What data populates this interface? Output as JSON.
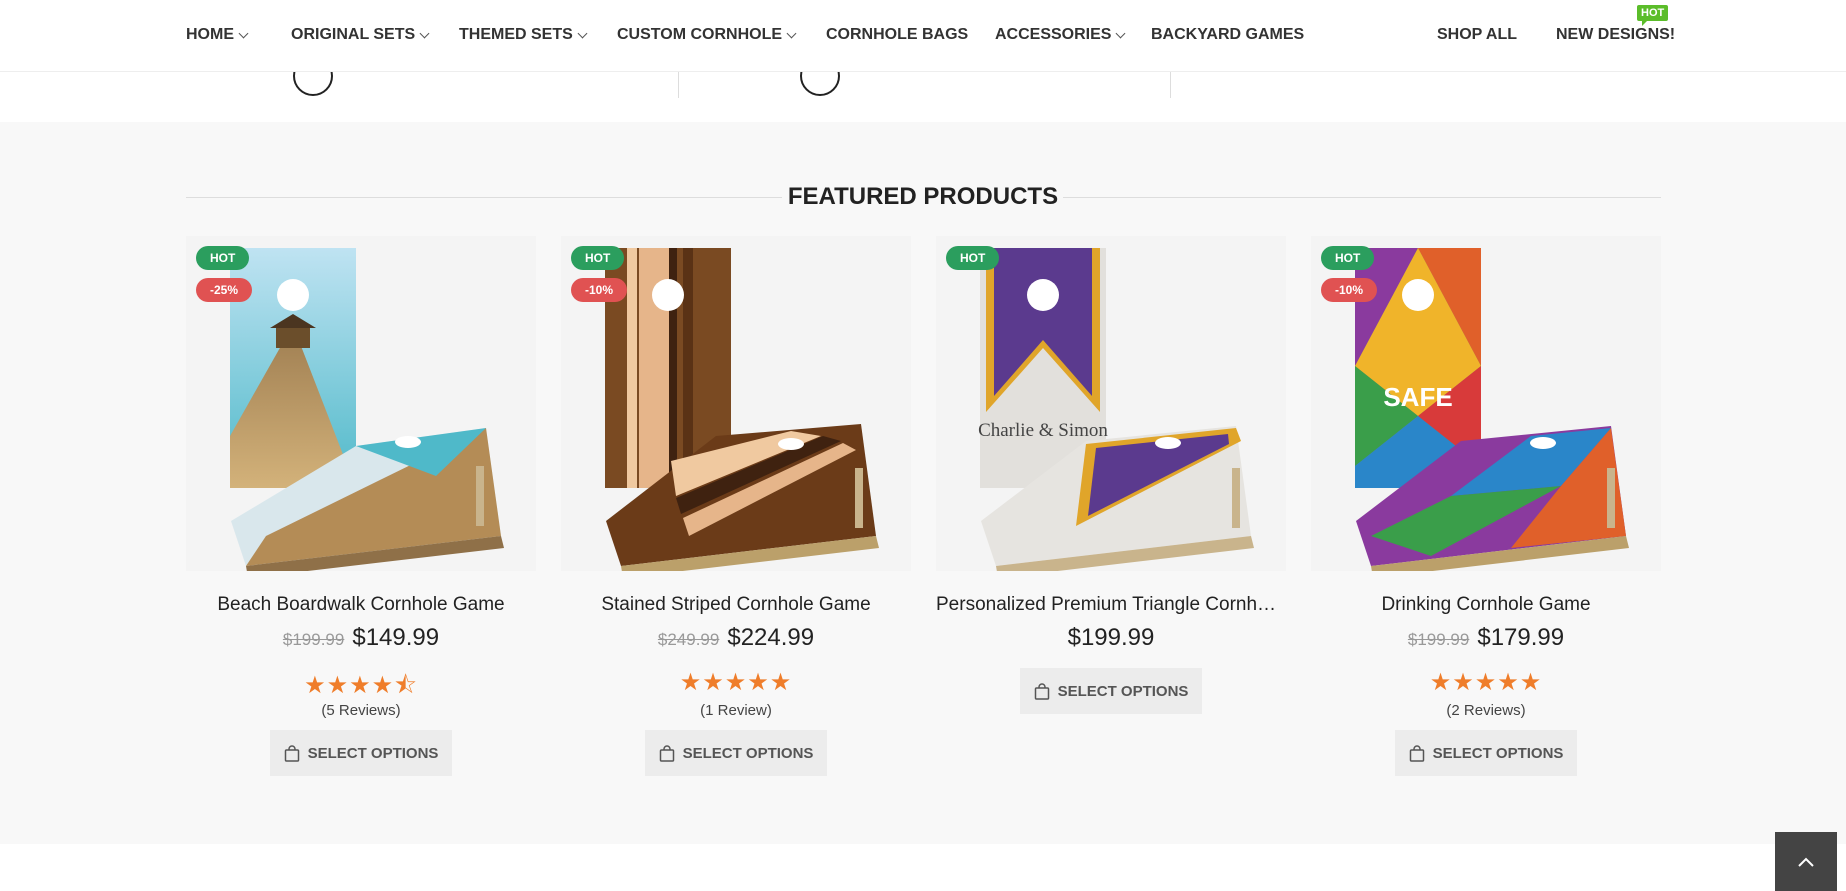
{
  "nav": {
    "items": [
      {
        "label": "HOME"
      },
      {
        "label": "ORIGINAL SETS"
      },
      {
        "label": "THEMED SETS"
      },
      {
        "label": "CUSTOM CORNHOLE"
      },
      {
        "label": "CORNHOLE BAGS"
      },
      {
        "label": "ACCESSORIES"
      },
      {
        "label": "BACKYARD GAMES"
      },
      {
        "label": "SHOP ALL"
      },
      {
        "label": "NEW DESIGNS!"
      }
    ],
    "hot_badge": "HOT"
  },
  "section": {
    "title": "FEATURED PRODUCTS"
  },
  "products": [
    {
      "name": "Beach Boardwalk Cornhole Game",
      "badge_hot": "HOT",
      "badge_sale": "-25%",
      "old_price": "$199.99",
      "price": "$149.99",
      "rating": 4.5,
      "stars": "★★★★⯪",
      "reviews": "(5 Reviews)",
      "button": "SELECT OPTIONS"
    },
    {
      "name": "Stained Striped Cornhole Game",
      "badge_hot": "HOT",
      "badge_sale": "-10%",
      "old_price": "$249.99",
      "price": "$224.99",
      "rating": 5,
      "stars": "★★★★★",
      "reviews": "(1 Review)",
      "button": "SELECT OPTIONS"
    },
    {
      "name": "Personalized Premium Triangle Cornhole Game",
      "badge_hot": "HOT",
      "price": "$199.99",
      "board_text": "Charlie & Simon",
      "button": "SELECT OPTIONS"
    },
    {
      "name": "Drinking Cornhole Game",
      "badge_hot": "HOT",
      "badge_sale": "-10%",
      "old_price": "$199.99",
      "price": "$179.99",
      "rating": 5,
      "stars": "★★★★★",
      "reviews": "(2 Reviews)",
      "button": "SELECT OPTIONS",
      "board_text": "SAFE"
    }
  ],
  "colors": {
    "hot_badge": "#2b9e5e",
    "sale_badge": "#e05252",
    "stars": "#ef7d2a",
    "nav_hot": "#5bbd2a"
  }
}
